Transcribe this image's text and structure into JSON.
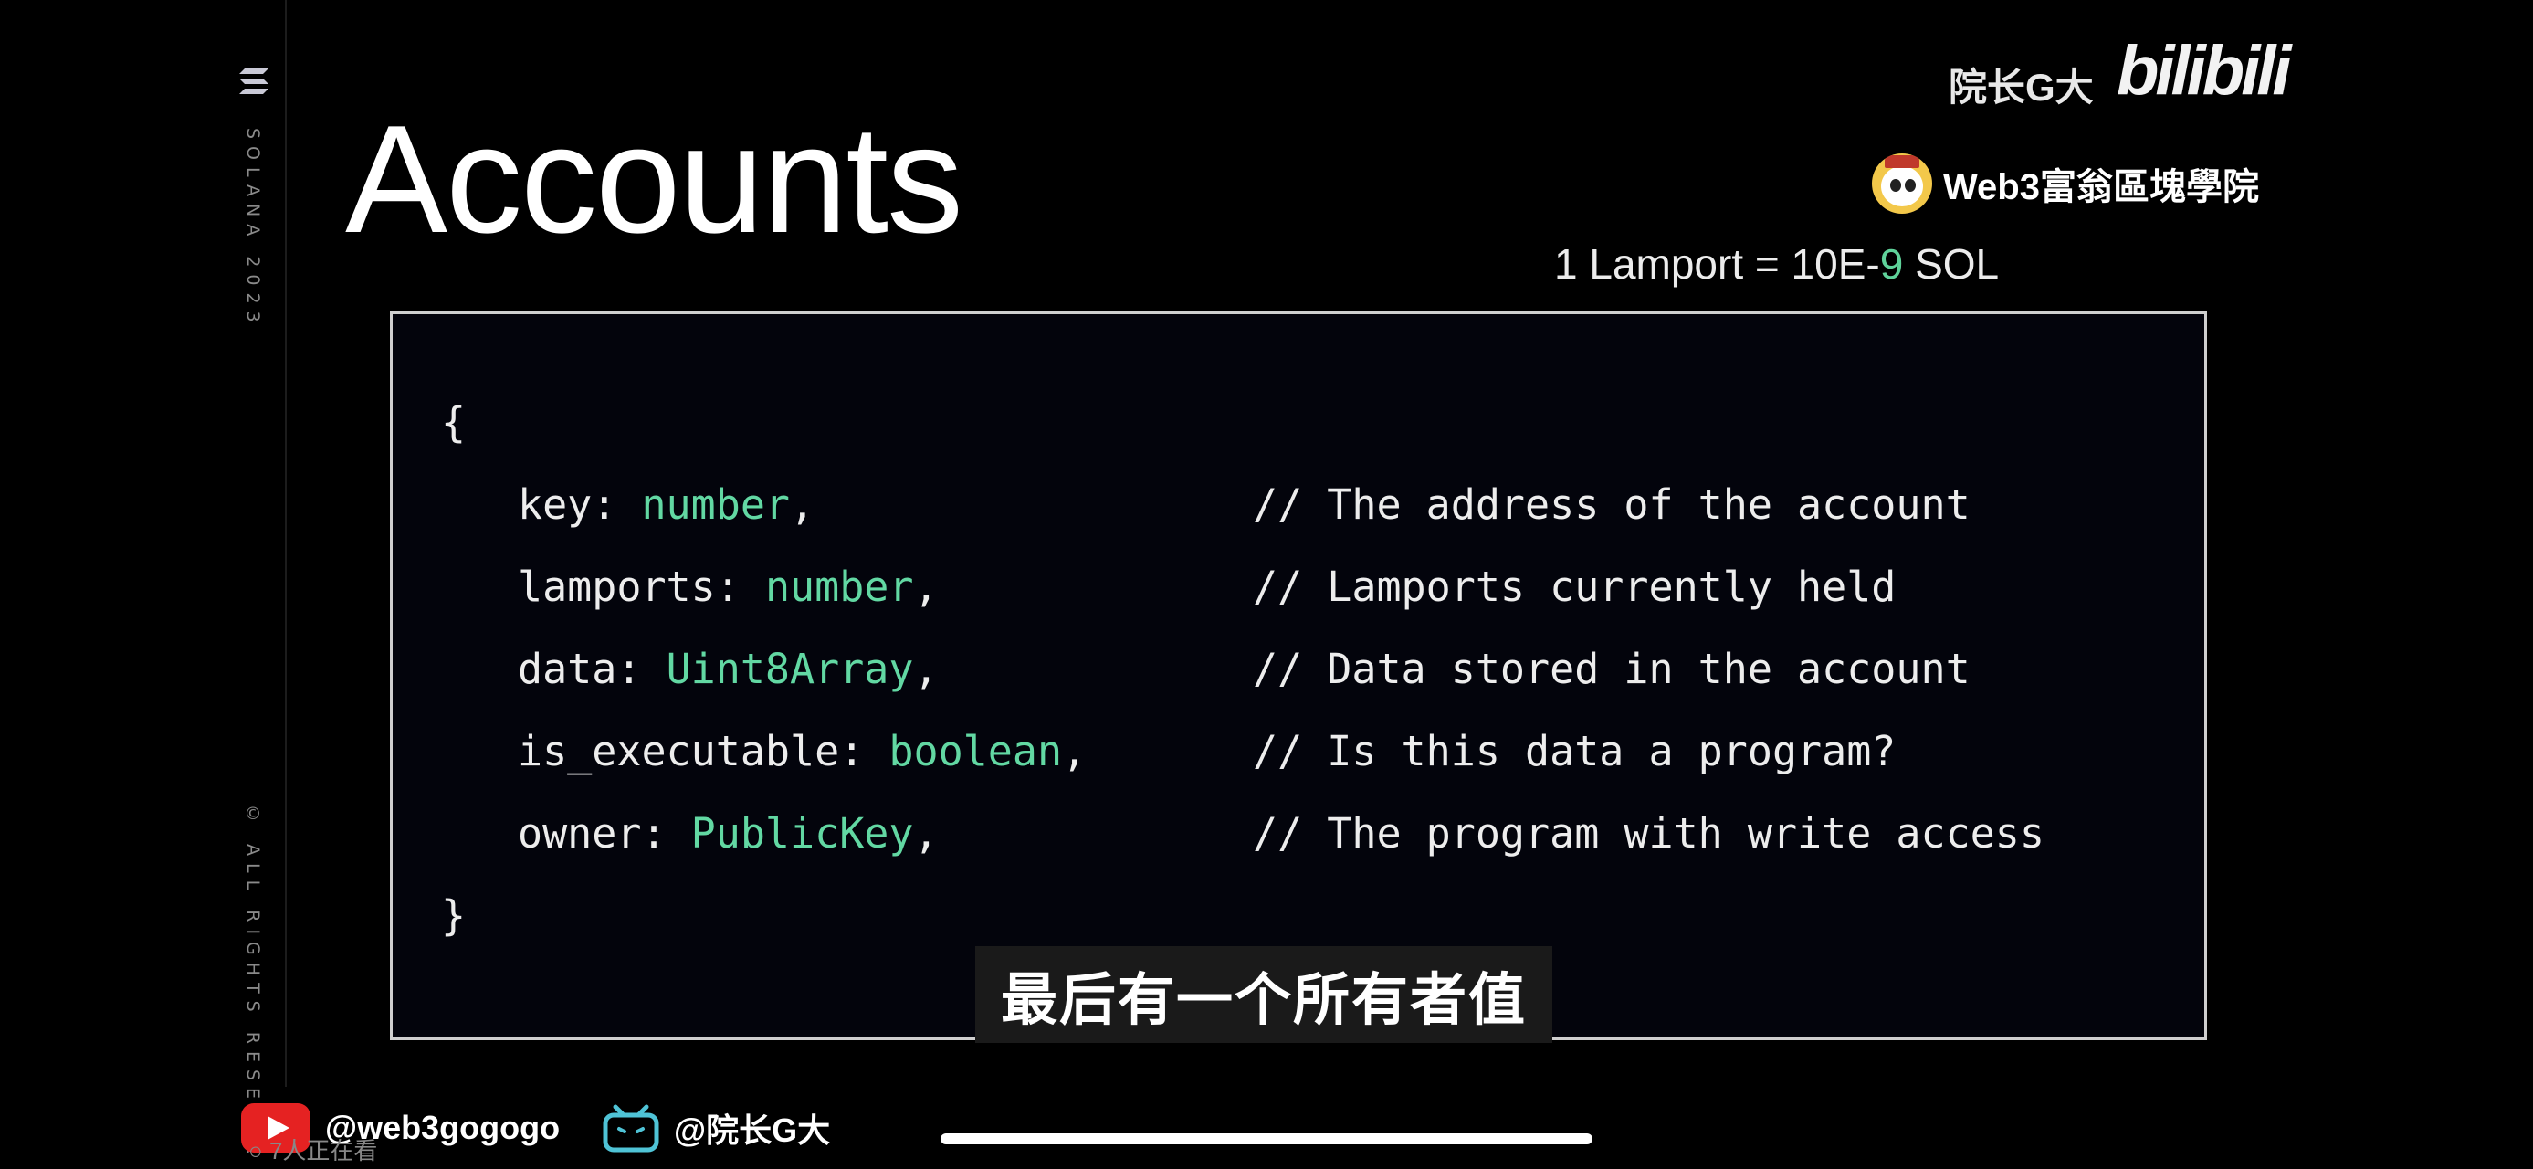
{
  "slide": {
    "title": "Accounts",
    "sidebar_vertical": "SOLANA 2023",
    "sidebar_rights": "© ALL RIGHTS RESERVE",
    "lamport_prefix": "1 Lamport = 10E-",
    "lamport_exp": "9",
    "lamport_suffix": " SOL"
  },
  "watermark": {
    "creator": "院长G大",
    "platform_logo": "bilibili",
    "channel": "Web3富翁區塊學院"
  },
  "code": {
    "open_brace": "{",
    "close_brace": "}",
    "lines": [
      {
        "field": "key: ",
        "type": "number",
        "comma": ",",
        "comment": "// The address of the account"
      },
      {
        "field": "lamports: ",
        "type": "number",
        "comma": ",",
        "comment": "// Lamports currently held"
      },
      {
        "field": "data: ",
        "type": "Uint8Array",
        "comma": ",",
        "comment": "// Data stored in the account"
      },
      {
        "field": "is_executable: ",
        "type": "boolean",
        "comma": ",",
        "comment": "// Is this data a program?"
      },
      {
        "field": "owner: ",
        "type": "PublicKey",
        "comma": ",",
        "comment": "// The program with write access"
      }
    ]
  },
  "subtitle": "最后有一个所有者值",
  "social": {
    "youtube_handle": "@web3gogogo",
    "bilibili_handle": "@院长G大",
    "viewers": "7人正在看"
  },
  "colors": {
    "type_color": "#62d8a3",
    "youtube_red": "#e52222",
    "bilibili_cyan": "#4fc3d6"
  },
  "icons": [
    "solana-logo-icon",
    "panda-avatar-icon",
    "youtube-icon",
    "bilibili-tv-icon",
    "viewers-icon"
  ]
}
